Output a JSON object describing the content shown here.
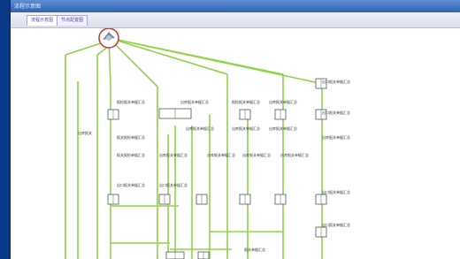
{
  "window": {
    "title": "流程示意图"
  },
  "tabs": [
    {
      "label": "流程示意图",
      "active": true
    },
    {
      "label": "节点配置图",
      "active": false
    }
  ],
  "colors": {
    "desktop": "#1b5cbf",
    "line": "#8fd34a",
    "node_border": "#555555",
    "start_ring": "#c0392b"
  },
  "node_labels": [
    "出口报关单据汇总",
    "出口报关单据汇总",
    "报检报关单据汇总",
    "出库报关单据汇总",
    "报检报关单据汇总",
    "出库报关单据汇总",
    "报关报检单据汇总",
    "出库报关单据汇总",
    "出库报关单据汇总",
    "出库报关单据汇总",
    "出库报关单据汇总",
    "报关报检单据汇总",
    "出库报关单据汇总",
    "出库报关单据汇总",
    "出库报关单据汇总",
    "出库报关单据汇总",
    "出口报关单据汇总",
    "出口报关单据汇总",
    "出口报关单据汇总",
    "出口报关单据汇总",
    "出库报关",
    "报关单据汇总"
  ]
}
